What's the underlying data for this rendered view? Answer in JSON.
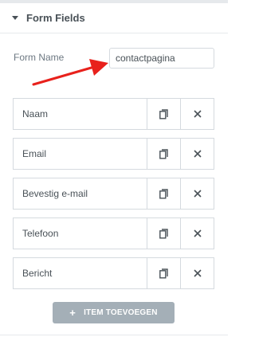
{
  "section": {
    "title": "Form Fields"
  },
  "form_name": {
    "label": "Form Name",
    "value": "contactpagina"
  },
  "fields": [
    {
      "label": "Naam"
    },
    {
      "label": "Email"
    },
    {
      "label": "Bevestig e-mail"
    },
    {
      "label": "Telefoon"
    },
    {
      "label": "Bericht"
    }
  ],
  "add_item": {
    "icon": "+",
    "label": "ITEM TOEVOEGEN"
  },
  "colors": {
    "annotation_arrow": "#e8211c",
    "add_button_bg": "#a4afb7"
  },
  "icons": {
    "duplicate": "copy-icon",
    "remove": "close-icon",
    "collapse": "caret-down-icon"
  }
}
